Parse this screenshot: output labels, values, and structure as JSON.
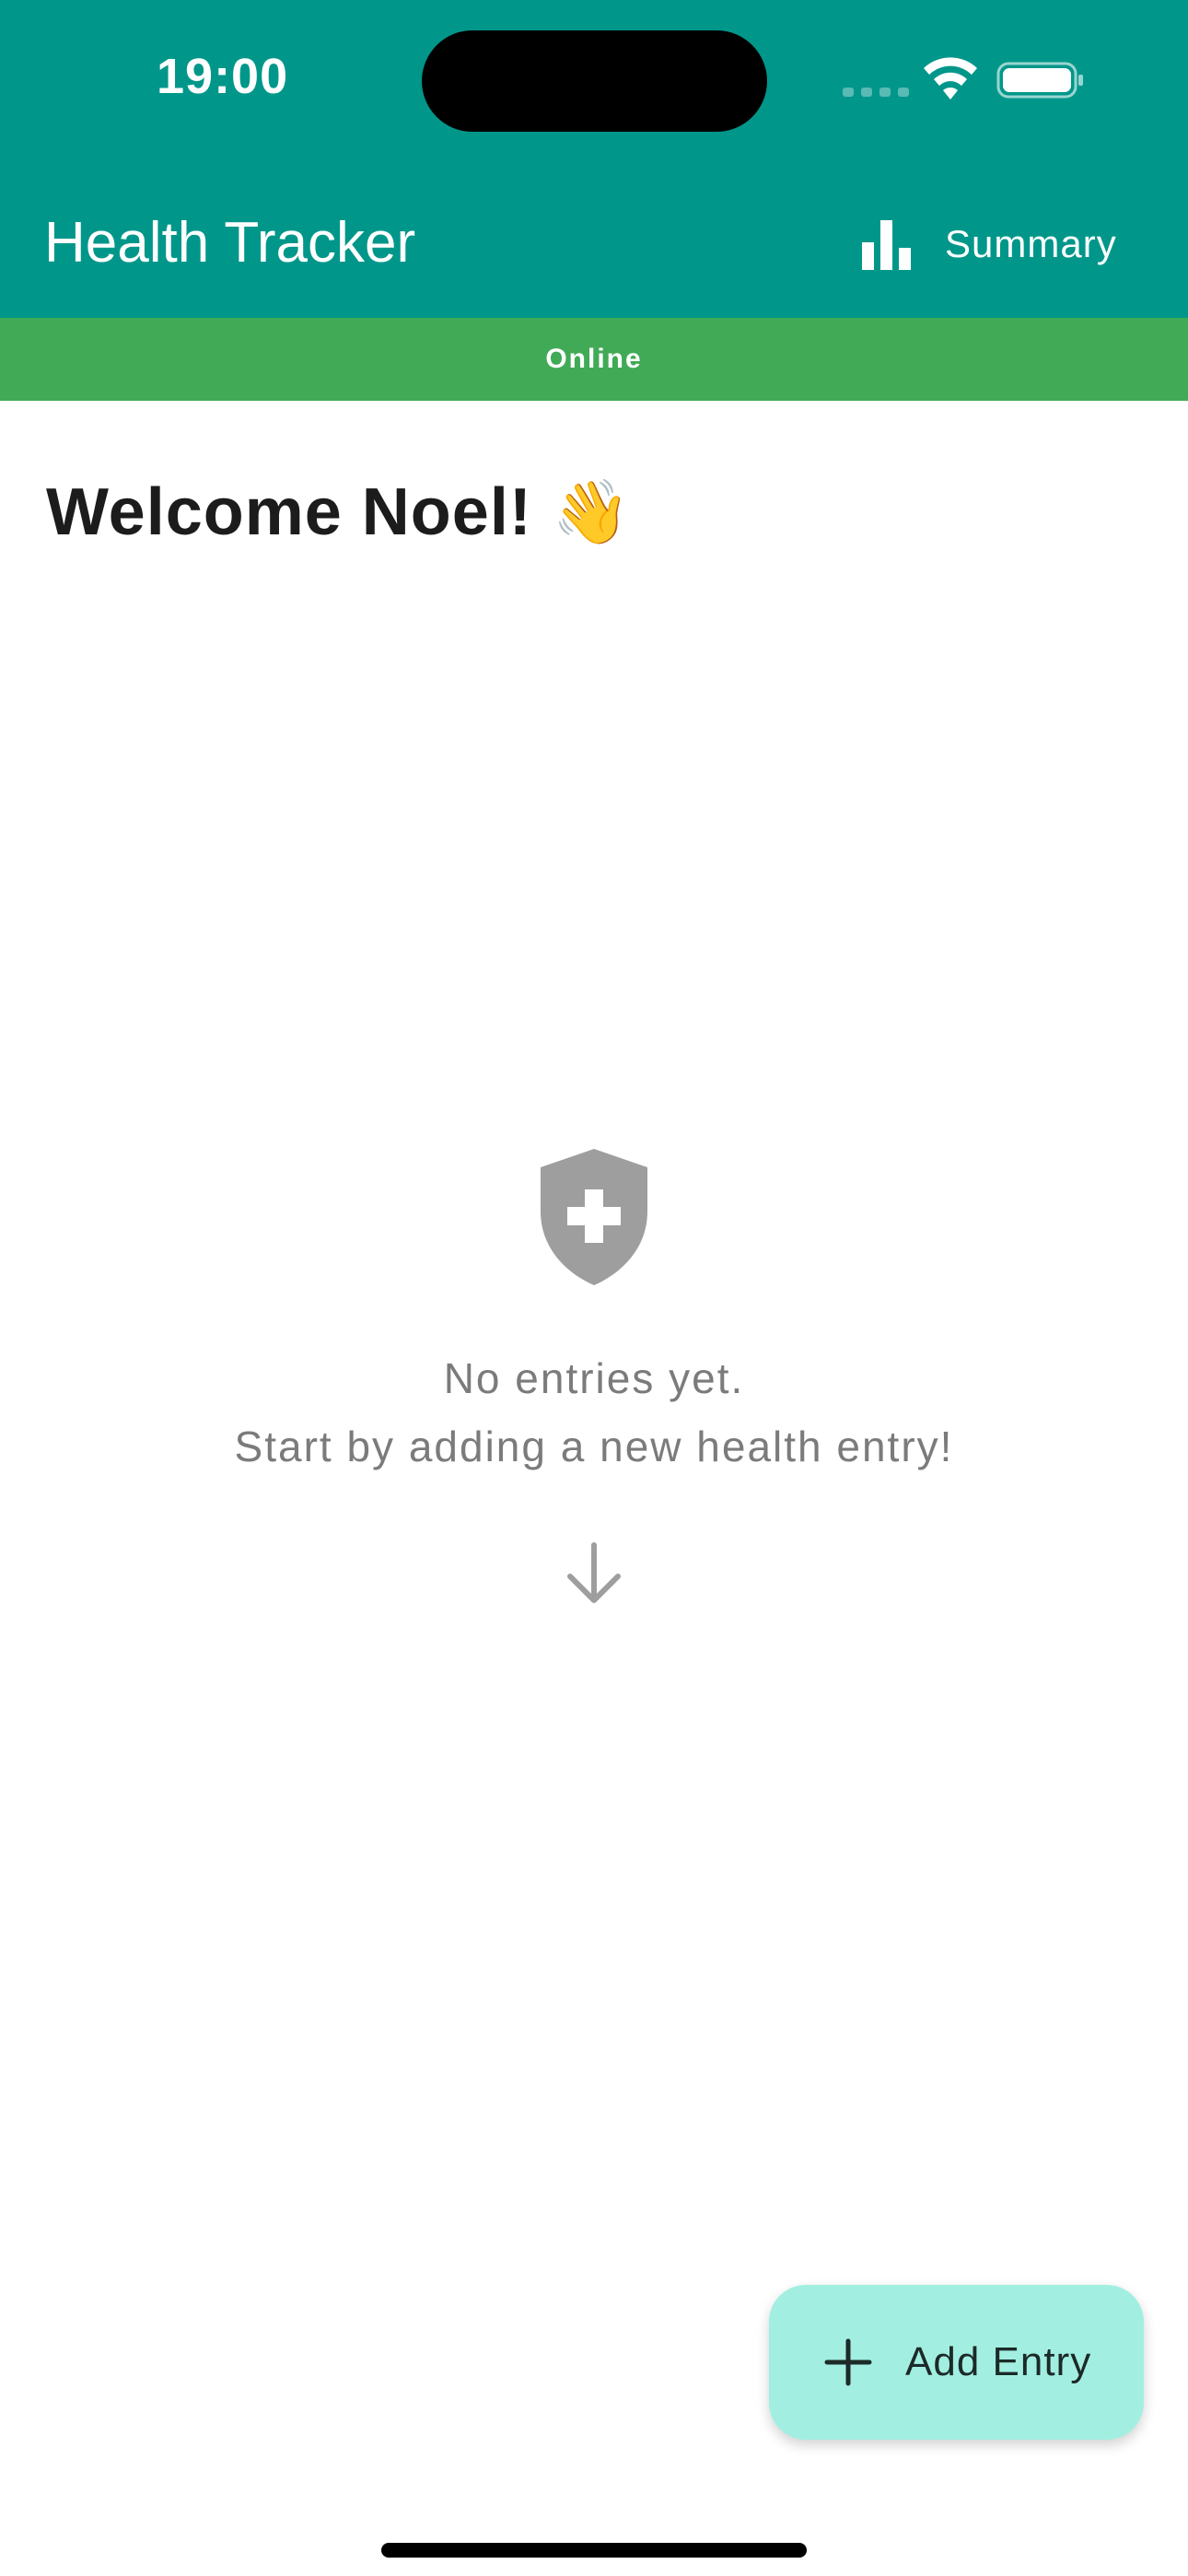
{
  "status_bar": {
    "time": "19:00"
  },
  "app_bar": {
    "title": "Health Tracker",
    "summary_label": "Summary",
    "summary_icon": "bar-chart-icon"
  },
  "connection": {
    "status": "Online"
  },
  "greeting": {
    "text": "Welcome Noel!",
    "emoji": "👋"
  },
  "empty_state": {
    "icon": "shield-plus-icon",
    "line1": "No entries yet.",
    "line2": "Start by adding a new health entry!",
    "arrow_icon": "arrow-down-icon"
  },
  "fab": {
    "label": "Add Entry",
    "icon": "plus-icon"
  },
  "colors": {
    "primary": "#00978a",
    "online": "#41aa56",
    "fab_bg": "#a2efe2",
    "muted_text": "#7b7b7b"
  }
}
